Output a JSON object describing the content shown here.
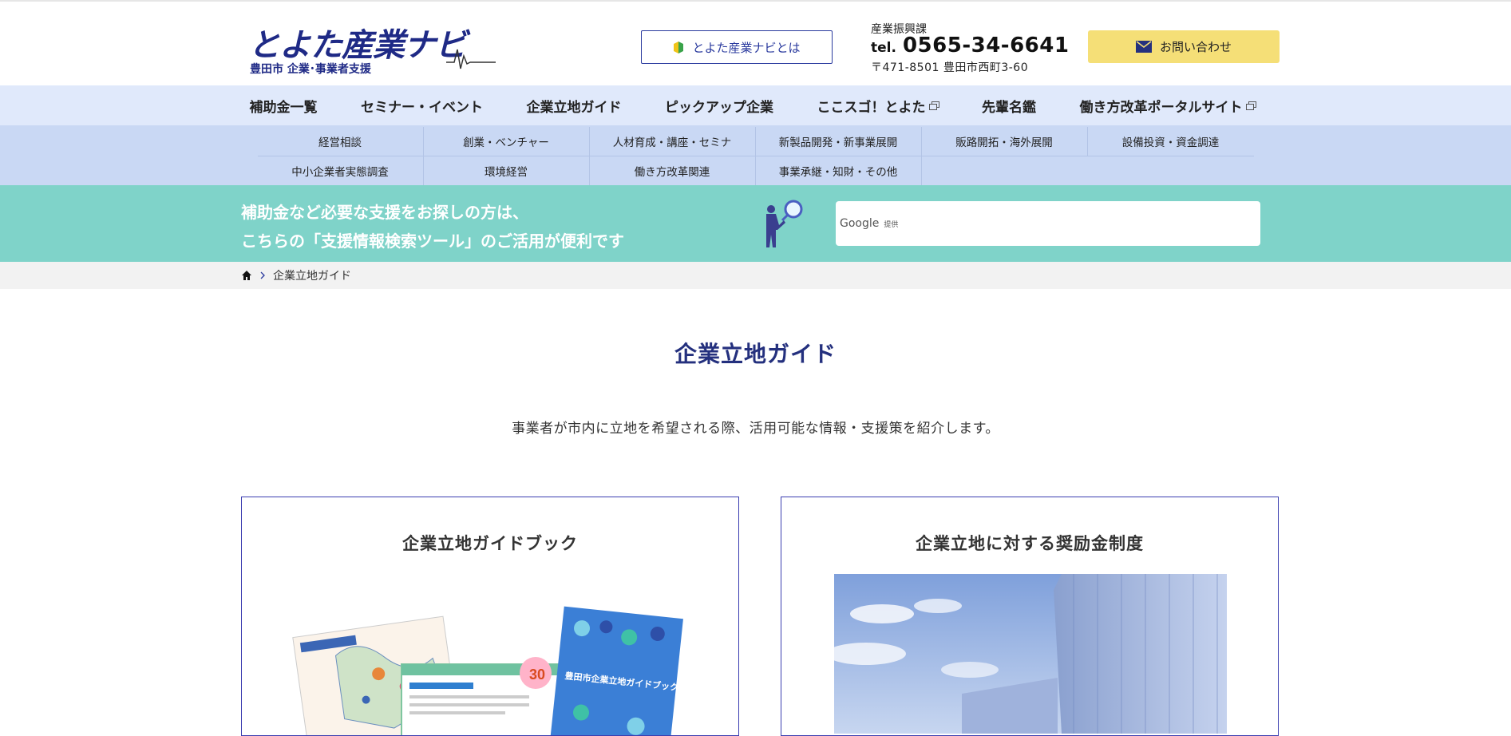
{
  "header": {
    "logo_title": "とよた産業ナビ",
    "logo_subtitle": "豊田市 企業･事業者支援",
    "about_label": "とよた産業ナビとは",
    "contact": {
      "department": "産業振興課",
      "tel_label": "tel.",
      "tel_number": "0565-34-6641",
      "address": "〒471-8501 豊田市西町3-60"
    },
    "inquiry_label": "お問い合わせ"
  },
  "main_nav": [
    {
      "label": "補助金一覧",
      "external": false
    },
    {
      "label": "セミナー・イベント",
      "external": false
    },
    {
      "label": "企業立地ガイド",
      "external": false
    },
    {
      "label": "ピックアップ企業",
      "external": false
    },
    {
      "label": "ここスゴ！とよた",
      "external": true
    },
    {
      "label": "先輩名鑑",
      "external": false
    },
    {
      "label": "働き方改革ポータルサイト",
      "external": true
    }
  ],
  "sub_nav": [
    "経営相談",
    "創業・ベンチャー",
    "人材育成・講座・セミナ",
    "新製品開発・新事業展開",
    "販路開拓・海外展開",
    "設備投資・資金調達",
    "中小企業者実態調査",
    "環境経営",
    "働き方改革関連",
    "事業承継・知財・その他"
  ],
  "search_banner": {
    "line1": "補助金など必要な支援をお探しの方は、",
    "line2": "こちらの「支援情報検索ツール」のご活用が便利です",
    "google_label": "Google",
    "google_sub": "提供"
  },
  "breadcrumb": {
    "current": "企業立地ガイド"
  },
  "content": {
    "title": "企業立地ガイド",
    "lead": "事業者が市内に立地を希望される際、活用可能な情報・支援策を紹介します。",
    "cards": [
      {
        "title": "企業立地ガイドブック"
      },
      {
        "title": "企業立地に対する奨励金制度"
      }
    ],
    "guidebook_cover_text": "豊田市企業立地ガイドブック",
    "badge_text": "30"
  },
  "colors": {
    "brand_navy": "#1f2a86",
    "nav_bg": "#e0e9fb",
    "subnav_bg": "#c9d8f4",
    "banner_bg": "#7fd3c9",
    "inquiry_bg": "#f5df77",
    "card_border": "#3b3eb0"
  }
}
